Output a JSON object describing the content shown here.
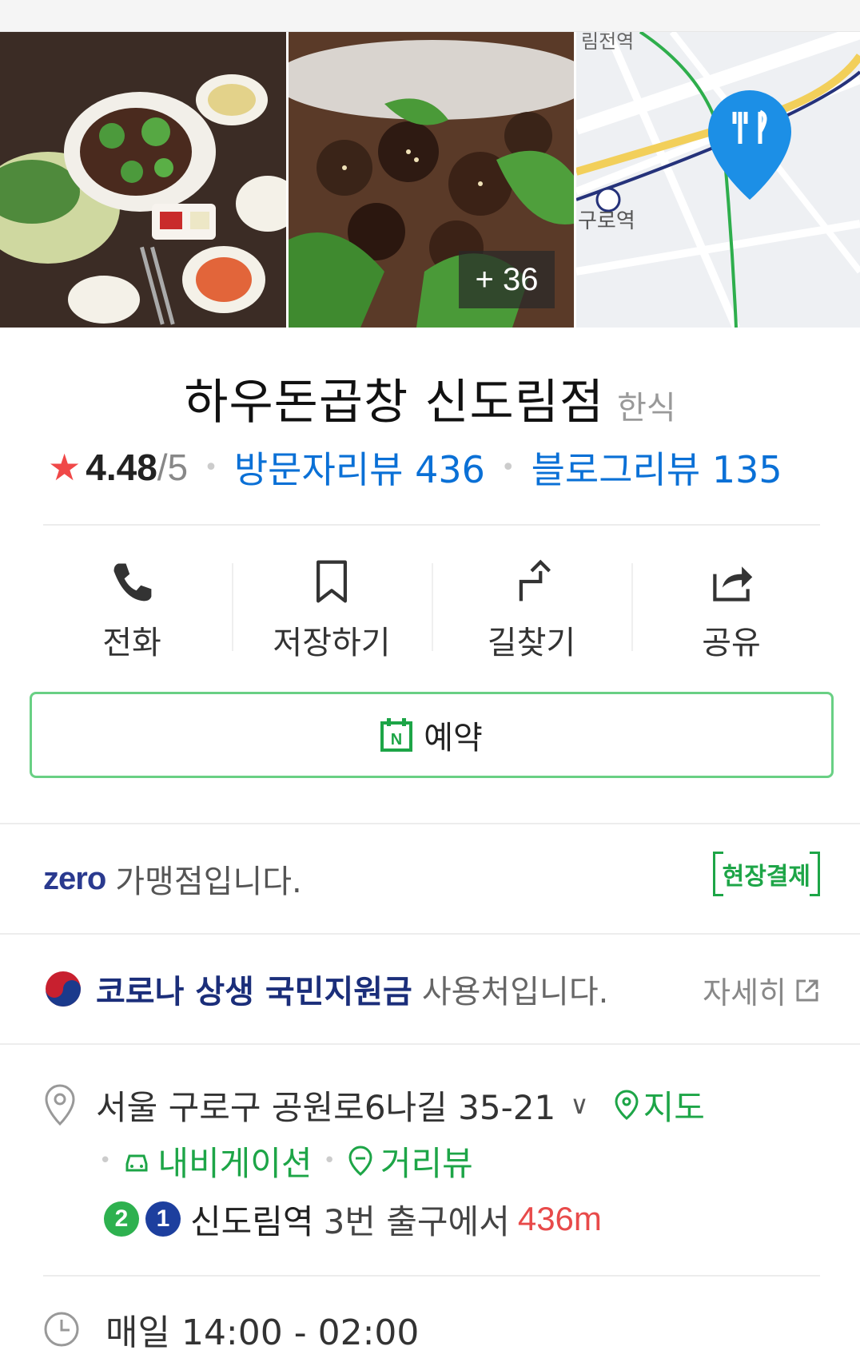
{
  "photos": {
    "more_count": "+ 36",
    "map_labels": {
      "station_top": "림전역",
      "station_left": "구로역"
    }
  },
  "place": {
    "name": "하우돈곱창 신도림점",
    "category": "한식",
    "rating_value": "4.48",
    "rating_max": "/5",
    "visitor_reviews": "방문자리뷰 436",
    "blog_reviews": "블로그리뷰 135"
  },
  "actions": [
    {
      "label": "전화",
      "icon": "phone-icon"
    },
    {
      "label": "저장하기",
      "icon": "bookmark-icon"
    },
    {
      "label": "길찾기",
      "icon": "directions-icon"
    },
    {
      "label": "공유",
      "icon": "share-icon"
    }
  ],
  "reserve": {
    "label": "예약",
    "icon": "naver-calendar-icon"
  },
  "zero_pay": {
    "logo": "zero",
    "text": "가맹점입니다.",
    "badge": "현장결제"
  },
  "corona": {
    "strong": "코로나 상생 국민지원금",
    "text": "사용처입니다.",
    "detail": "자세히"
  },
  "address": {
    "text": "서울 구로구 공원로6나길 35-21",
    "map_link": "지도",
    "navigation_link": "내비게이션",
    "streetview_link": "거리뷰",
    "subway_lines": [
      "2",
      "1"
    ],
    "station": "신도림역",
    "exit": "3번 출구에서",
    "distance": "436m"
  },
  "hours": {
    "text": "매일 14:00 - 02:00"
  },
  "colors": {
    "accent_green": "#1da547",
    "link_blue": "#0a70d6",
    "star_red": "#f04848",
    "line2": "#2eb14f",
    "line1": "#1d3f9e"
  }
}
